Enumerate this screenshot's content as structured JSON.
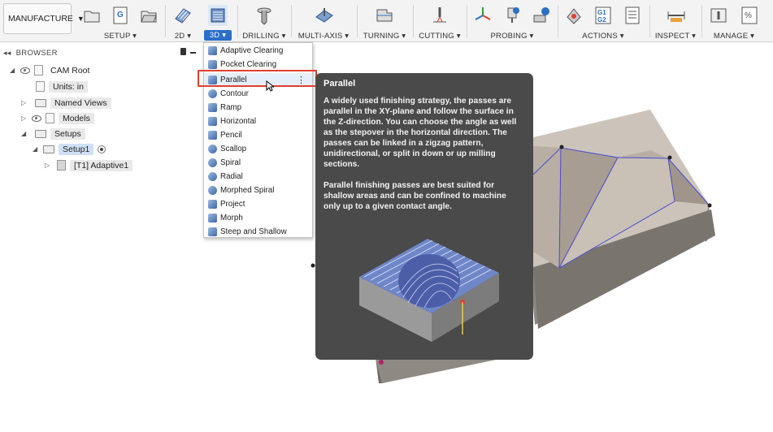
{
  "workspace": {
    "label": "MANUFACTURE"
  },
  "toolbar": {
    "groups": [
      {
        "label": "SETUP ▾",
        "icons": [
          "folder-icon",
          "g-code-icon",
          "open-folder-icon"
        ]
      },
      {
        "label": "2D ▾",
        "icons": [
          "2d-milling-icon"
        ]
      },
      {
        "label": "3D ▾",
        "icons": [
          "3d-milling-icon"
        ],
        "active": true
      },
      {
        "label": "DRILLING ▾",
        "icons": [
          "drilling-icon"
        ]
      },
      {
        "label": "MULTI-AXIS ▾",
        "icons": [
          "multi-axis-icon"
        ]
      },
      {
        "label": "TURNING ▾",
        "icons": [
          "turning-icon"
        ]
      },
      {
        "label": "CUTTING ▾",
        "icons": [
          "cutting-icon"
        ]
      },
      {
        "label": "PROBING ▾",
        "icons": [
          "probe-axes-icon",
          "probe-tool-icon",
          "probe-part-icon"
        ]
      },
      {
        "label": "ACTIONS ▾",
        "icons": [
          "simulate-icon",
          "post-process-icon",
          "setup-sheet-icon"
        ]
      },
      {
        "label": "INSPECT ▾",
        "icons": [
          "measure-icon"
        ]
      },
      {
        "label": "MANAGE ▾",
        "icons": [
          "tool-library-icon",
          "templates-icon"
        ]
      }
    ]
  },
  "browser": {
    "title": "BROWSER",
    "items": [
      {
        "label": "CAM Root"
      },
      {
        "label": "Units: in"
      },
      {
        "label": "Named Views"
      },
      {
        "label": "Models"
      },
      {
        "label": "Setups"
      },
      {
        "label": "Setup1"
      },
      {
        "label": "[T1] Adaptive1"
      }
    ]
  },
  "menu": {
    "items": [
      {
        "label": "Adaptive Clearing"
      },
      {
        "label": "Pocket Clearing"
      },
      {
        "label": "Parallel",
        "highlighted": true
      },
      {
        "label": "Contour"
      },
      {
        "label": "Ramp"
      },
      {
        "label": "Horizontal"
      },
      {
        "label": "Pencil"
      },
      {
        "label": "Scallop"
      },
      {
        "label": "Spiral"
      },
      {
        "label": "Radial"
      },
      {
        "label": "Morphed Spiral"
      },
      {
        "label": "Project"
      },
      {
        "label": "Morph"
      },
      {
        "label": "Steep and Shallow"
      }
    ]
  },
  "tooltip": {
    "title": "Parallel",
    "paragraph1": "A widely used finishing strategy, the passes are parallel in the XY-plane and follow the surface in the Z-direction. You can choose the angle as well as the stepover in the horizontal direction. The passes can be linked in a zigzag pattern, unidirectional, or split in down or up milling sections.",
    "paragraph2": "Parallel finishing passes are best suited for shallow areas and can be confined to machine only up to a given contact angle."
  },
  "colors": {
    "accent": "#2b6fc8",
    "highlight_box": "#e0402f",
    "tooltip_bg": "#4a4a4a"
  }
}
